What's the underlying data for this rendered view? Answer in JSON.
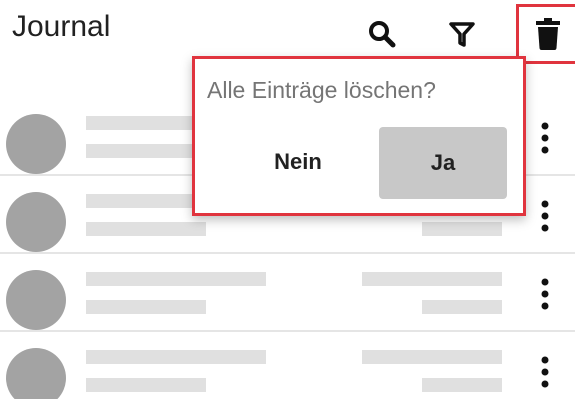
{
  "header": {
    "title": "Journal",
    "icons": [
      "search-icon",
      "filter-icon",
      "trash-icon"
    ]
  },
  "popover": {
    "question": "Alle Einträge löschen?",
    "no_label": "Nein",
    "yes_label": "Ja"
  },
  "list": {
    "row_count": 4,
    "row_icon": "more-vert-icon"
  },
  "colors": {
    "highlight": "#e0343e",
    "avatar": "#a3a3a3",
    "placeholder": "#e0e0e0",
    "yes_button": "#c8c8c8"
  }
}
